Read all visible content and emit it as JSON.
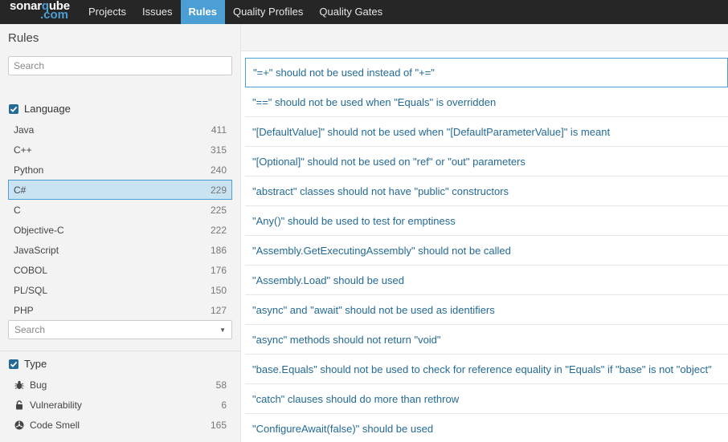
{
  "logo": {
    "line1_a": "sonar",
    "line1_b": "q",
    "line1_c": "ube",
    "line2": ".com"
  },
  "nav": {
    "items": [
      {
        "label": "Projects",
        "active": false
      },
      {
        "label": "Issues",
        "active": false
      },
      {
        "label": "Rules",
        "active": true
      },
      {
        "label": "Quality Profiles",
        "active": false
      },
      {
        "label": "Quality Gates",
        "active": false
      }
    ]
  },
  "sidebar": {
    "title": "Rules",
    "search_placeholder": "Search",
    "language": {
      "heading": "Language",
      "items": [
        {
          "name": "Java",
          "count": "411"
        },
        {
          "name": "C++",
          "count": "315"
        },
        {
          "name": "Python",
          "count": "240"
        },
        {
          "name": "C#",
          "count": "229",
          "selected": true
        },
        {
          "name": "C",
          "count": "225"
        },
        {
          "name": "Objective-C",
          "count": "222"
        },
        {
          "name": "JavaScript",
          "count": "186"
        },
        {
          "name": "COBOL",
          "count": "176"
        },
        {
          "name": "PL/SQL",
          "count": "150"
        },
        {
          "name": "PHP",
          "count": "127"
        }
      ],
      "more_search_placeholder": "Search"
    },
    "type": {
      "heading": "Type",
      "items": [
        {
          "name": "Bug",
          "count": "58",
          "icon": "bug-icon"
        },
        {
          "name": "Vulnerability",
          "count": "6",
          "icon": "lock-icon"
        },
        {
          "name": "Code Smell",
          "count": "165",
          "icon": "code-smell-icon"
        }
      ]
    }
  },
  "rules": [
    "\"=+\" should not be used instead of \"+=\"",
    "\"==\" should not be used when \"Equals\" is overridden",
    "\"[DefaultValue]\" should not be used when \"[DefaultParameterValue]\" is meant",
    "\"[Optional]\" should not be used on \"ref\" or \"out\" parameters",
    "\"abstract\" classes should not have \"public\" constructors",
    "\"Any()\" should be used to test for emptiness",
    "\"Assembly.GetExecutingAssembly\" should not be called",
    "\"Assembly.Load\" should be used",
    "\"async\" and \"await\" should not be used as identifiers",
    "\"async\" methods should not return \"void\"",
    "\"base.Equals\" should not be used to check for reference equality in \"Equals\" if \"base\" is not \"object\"",
    "\"catch\" clauses should do more than rethrow",
    "\"ConfigureAwait(false)\" should be used"
  ],
  "colors": {
    "accent": "#4b9fd5",
    "link": "#236a97",
    "topbar": "#262626",
    "sidebar_bg": "#f3f3f3",
    "selected_bg": "#cae3f2"
  }
}
